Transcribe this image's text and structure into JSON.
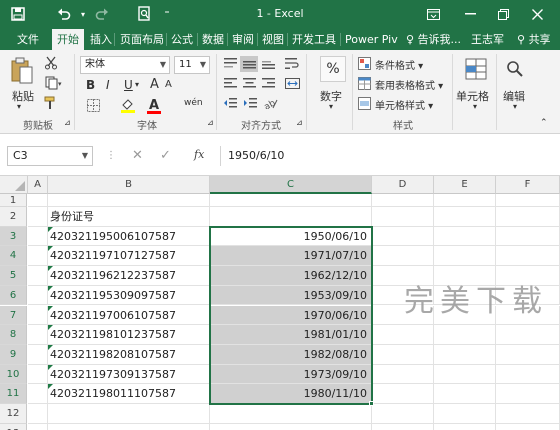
{
  "title_bar": {
    "title": "1 - Excel"
  },
  "menu": {
    "tabs": [
      "文件",
      "开始",
      "插入",
      "页面布局",
      "公式",
      "数据",
      "审阅",
      "视图",
      "开发工具",
      "Power Piv"
    ],
    "active_tab": "开始",
    "tell_me": "告诉我...",
    "user": "王志军",
    "share": "共享"
  },
  "ribbon": {
    "clipboard": {
      "paste": "粘贴",
      "label": "剪贴板"
    },
    "font": {
      "name": "宋体",
      "size": "11",
      "bold": "B",
      "italic": "I",
      "underline": "U",
      "font_color_letter": "A",
      "size_up": "A",
      "size_down": "A",
      "wen": "wén",
      "label": "字体"
    },
    "alignment": {
      "label": "对齐方式"
    },
    "number": {
      "percent": "%",
      "label": "数字"
    },
    "styles": {
      "conditional": "条件格式",
      "table": "套用表格格式",
      "cell_styles": "单元格样式",
      "label": "样式"
    },
    "cells": {
      "label": "单元格"
    },
    "editing": {
      "label": "编辑"
    }
  },
  "formula_bar": {
    "name_box": "C3",
    "content": "1950/6/10"
  },
  "sheet": {
    "columns": [
      "A",
      "B",
      "C",
      "D",
      "E",
      "F"
    ],
    "selected_column": "C",
    "row_numbers": [
      "1",
      "2",
      "3",
      "4",
      "5",
      "6",
      "7",
      "8",
      "9",
      "10",
      "11",
      "12",
      "13"
    ],
    "header_text": "身份证号",
    "rows": [
      {
        "id": "420321195006107587",
        "date": "1950/06/10"
      },
      {
        "id": "420321197107127587",
        "date": "1971/07/10"
      },
      {
        "id": "420321196212237587",
        "date": "1962/12/10"
      },
      {
        "id": "420321195309097587",
        "date": "1953/09/10"
      },
      {
        "id": "420321197006107587",
        "date": "1970/06/10"
      },
      {
        "id": "420321198101237587",
        "date": "1981/01/10"
      },
      {
        "id": "420321198208107587",
        "date": "1982/08/10"
      },
      {
        "id": "420321197309137587",
        "date": "1973/09/10"
      },
      {
        "id": "420321198011107587",
        "date": "1980/11/10"
      }
    ]
  },
  "watermark": "完美下载",
  "colors": {
    "excel_green": "#217346",
    "selection_shade": "#d0d0d0",
    "ribbon_bg": "#f3f3f3"
  }
}
